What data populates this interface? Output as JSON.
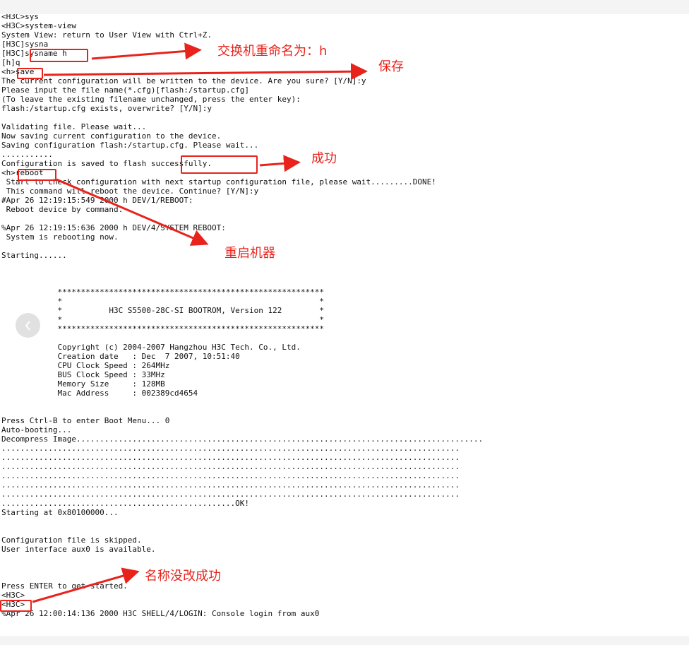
{
  "terminal": {
    "lines": [
      "<H3C>sys",
      "<H3C>system-view",
      "System View: return to User View with Ctrl+Z.",
      "[H3C]sysna",
      "[H3C]sysname h",
      "[h]q",
      "<h>save",
      "The current configuration will be written to the device. Are you sure? [Y/N]:y",
      "Please input the file name(*.cfg)[flash:/startup.cfg]",
      "(To leave the existing filename unchanged, press the enter key):",
      "flash:/startup.cfg exists, overwrite? [Y/N]:y",
      "",
      "Validating file. Please wait...",
      "Now saving current configuration to the device.",
      "Saving configuration flash:/startup.cfg. Please wait...",
      "...........",
      "Configuration is saved to flash successfully.",
      "<h>reboot",
      " Start to check configuration with next startup configuration file, please wait.........DONE!",
      " This command will reboot the device. Continue? [Y/N]:y",
      "#Apr 26 12:19:15:549 2000 h DEV/1/REBOOT:",
      " Reboot device by command.",
      "",
      "%Apr 26 12:19:15:636 2000 h DEV/4/SYSTEM REBOOT:",
      " System is rebooting now.",
      "",
      "Starting......",
      "",
      "",
      "",
      "            *********************************************************",
      "            *                                                       *",
      "            *          H3C S5500-28C-SI BOOTROM, Version 122        *",
      "            *                                                       *",
      "            *********************************************************",
      "",
      "            Copyright (c) 2004-2007 Hangzhou H3C Tech. Co., Ltd.",
      "            Creation date   : Dec  7 2007, 10:51:40",
      "            CPU Clock Speed : 264MHz",
      "            BUS Clock Speed : 33MHz",
      "            Memory Size     : 128MB",
      "            Mac Address     : 002389cd4654",
      "",
      "",
      "Press Ctrl-B to enter Boot Menu... 0",
      "Auto-booting...",
      "Decompress Image.......................................................................................",
      "..................................................................................................",
      "..................................................................................................",
      "..................................................................................................",
      "..................................................................................................",
      "..................................................................................................",
      "..................................................................................................",
      "..................................................OK!",
      "Starting at 0x80100000...",
      "",
      "",
      "Configuration file is skipped.",
      "User interface aux0 is available.",
      "",
      "",
      "",
      "Press ENTER to get started.",
      "<H3C>",
      "<H3C>",
      "%Apr 26 12:00:14:136 2000 H3C SHELL/4/LOGIN: Console login from aux0"
    ]
  },
  "annotations": {
    "rename": "交换机重命名为：h",
    "save": "保存",
    "success": "成功",
    "reboot": "重启机器",
    "name_not_changed": "名称没改成功"
  },
  "nav": {
    "prev_icon": "chevron-left-icon"
  },
  "colors": {
    "annotation": "#e8231c",
    "text": "#111111",
    "background": "#ffffff",
    "nav_button": "#dcdcdc"
  }
}
